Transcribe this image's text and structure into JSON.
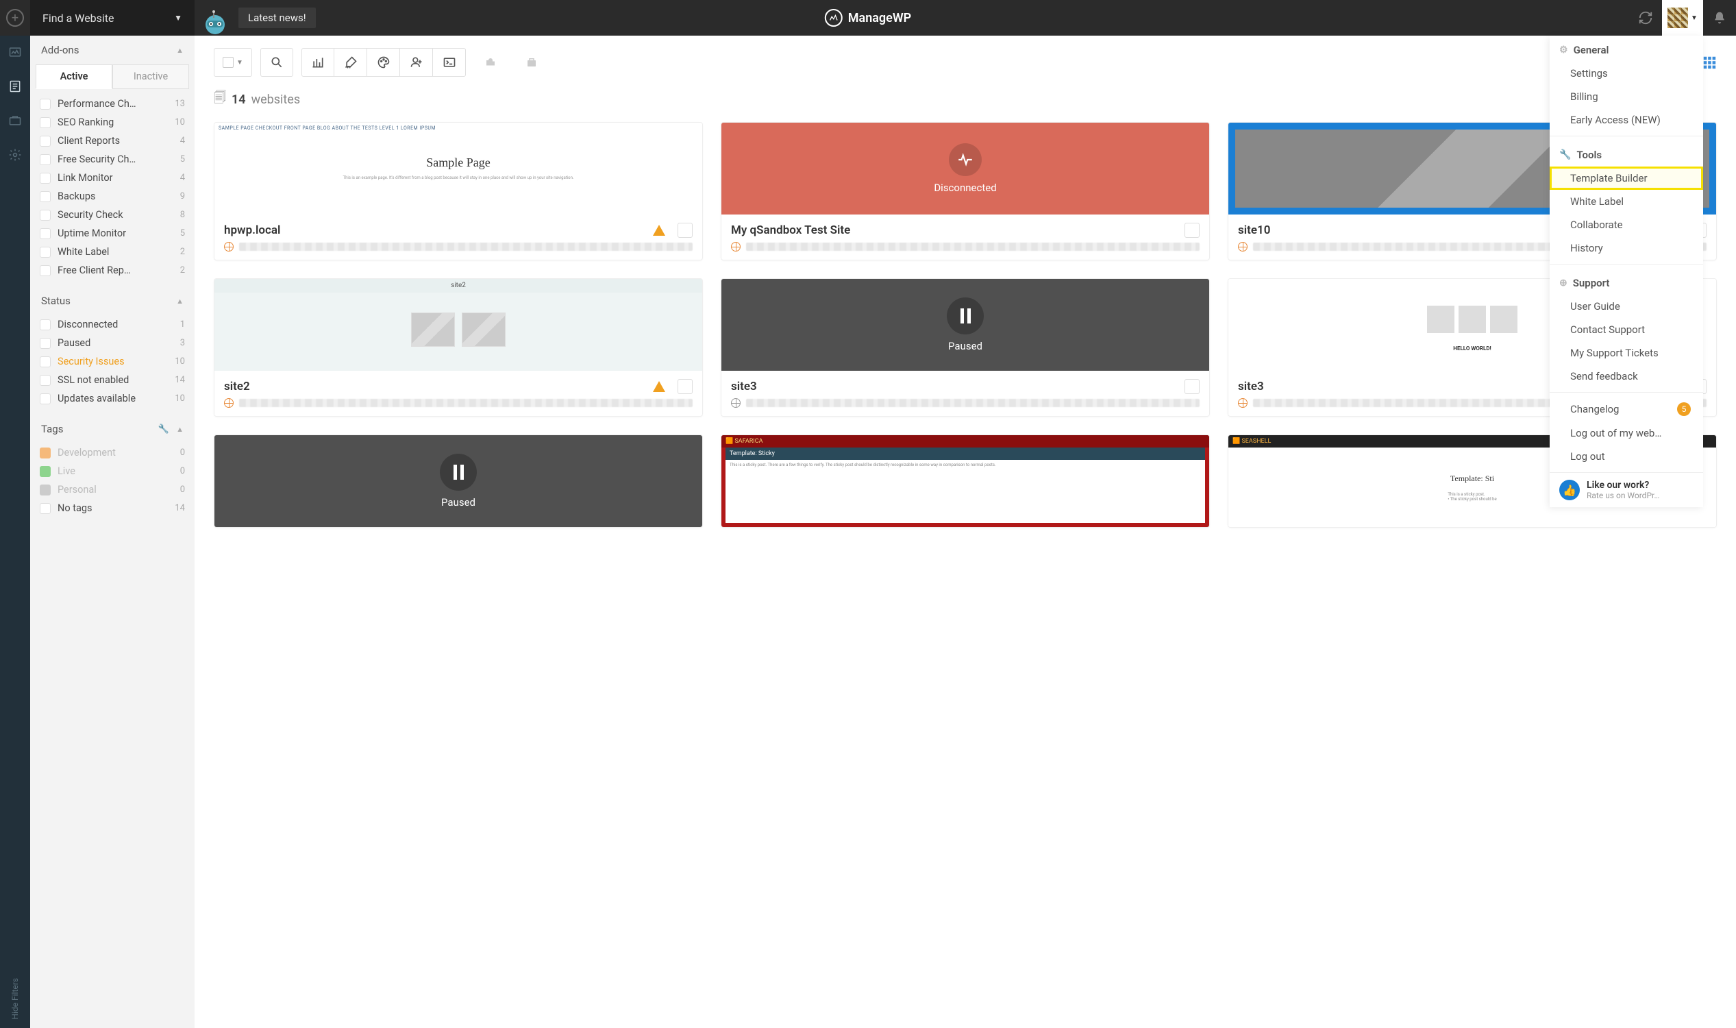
{
  "topbar": {
    "find_site": "Find a Website",
    "latest_news": "Latest news!",
    "brand": "ManageWP"
  },
  "leftbar_icons": [
    "dashboard",
    "report",
    "addons",
    "settings"
  ],
  "sidebar": {
    "addons_label": "Add-ons",
    "tabs": {
      "active": "Active",
      "inactive": "Inactive"
    },
    "addons": [
      {
        "label": "Performance Ch…",
        "count": 13
      },
      {
        "label": "SEO Ranking",
        "count": 10
      },
      {
        "label": "Client Reports",
        "count": 4
      },
      {
        "label": "Free Security Ch…",
        "count": 5
      },
      {
        "label": "Link Monitor",
        "count": 4
      },
      {
        "label": "Backups",
        "count": 9
      },
      {
        "label": "Security Check",
        "count": 8
      },
      {
        "label": "Uptime Monitor",
        "count": 5
      },
      {
        "label": "White Label",
        "count": 2
      },
      {
        "label": "Free Client Rep…",
        "count": 2
      }
    ],
    "status_label": "Status",
    "status": [
      {
        "label": "Disconnected",
        "count": 1
      },
      {
        "label": "Paused",
        "count": 3
      },
      {
        "label": "Security Issues",
        "count": 10,
        "highlight": true
      },
      {
        "label": "SSL not enabled",
        "count": 14
      },
      {
        "label": "Updates available",
        "count": 10
      }
    ],
    "tags_label": "Tags",
    "tags": [
      {
        "label": "Development",
        "count": 0,
        "swatch": "orange"
      },
      {
        "label": "Live",
        "count": 0,
        "swatch": "green"
      },
      {
        "label": "Personal",
        "count": 0,
        "swatch": "gray"
      },
      {
        "label": "No tags",
        "count": 14,
        "swatch": "white"
      }
    ],
    "hide_filters": "Hide Filters"
  },
  "main": {
    "count_num": "14",
    "count_word": "websites",
    "cards": [
      {
        "title": "hpwp.local",
        "warn": true,
        "thumb_type": "sample",
        "thumb_title": "Sample Page",
        "fake_nav": "SAMPLE PAGE   CHECKOUT   FRONT PAGE   BLOG   ABOUT THE TESTS   LEVEL 1   LOREM IPSUM"
      },
      {
        "title": "My qSandbox Test Site",
        "thumb_type": "disc",
        "overlay": "Disconnected"
      },
      {
        "title": "site10",
        "thumb_type": "blue"
      },
      {
        "title": "site2",
        "warn": true,
        "thumb_type": "site2",
        "thumb_label": "site2"
      },
      {
        "title": "site3",
        "thumb_type": "paused",
        "overlay": "Paused",
        "globe": "gray"
      },
      {
        "title": "site3",
        "thumb_type": "generic"
      },
      {
        "title": "",
        "thumb_type": "paused",
        "overlay": "Paused",
        "globe": "gray",
        "partial": true
      },
      {
        "title": "",
        "thumb_type": "safarica",
        "label": "🟧 SAFARICA",
        "bar": "Template: Sticky",
        "partial": true
      },
      {
        "title": "",
        "thumb_type": "seashell",
        "label": "🟧 SEASHELL",
        "bar": "Template: Sti",
        "partial": true
      }
    ]
  },
  "dropdown": {
    "groups": [
      {
        "head": "General",
        "icon": "gear",
        "items": [
          {
            "label": "Settings"
          },
          {
            "label": "Billing"
          },
          {
            "label": "Early Access (NEW)"
          }
        ]
      },
      {
        "head": "Tools",
        "icon": "wrench",
        "items": [
          {
            "label": "Template Builder",
            "highlight": true
          },
          {
            "label": "White Label"
          },
          {
            "label": "Collaborate"
          },
          {
            "label": "History"
          }
        ]
      },
      {
        "head": "Support",
        "icon": "lifebuoy",
        "items": [
          {
            "label": "User Guide"
          },
          {
            "label": "Contact Support"
          },
          {
            "label": "My Support Tickets"
          },
          {
            "label": "Send feedback"
          }
        ]
      }
    ],
    "extras": [
      {
        "label": "Changelog",
        "badge": "5"
      },
      {
        "label": "Log out of my web…"
      },
      {
        "label": "Log out"
      }
    ],
    "foot_title": "Like our work?",
    "foot_sub": "Rate us on WordPr…"
  }
}
